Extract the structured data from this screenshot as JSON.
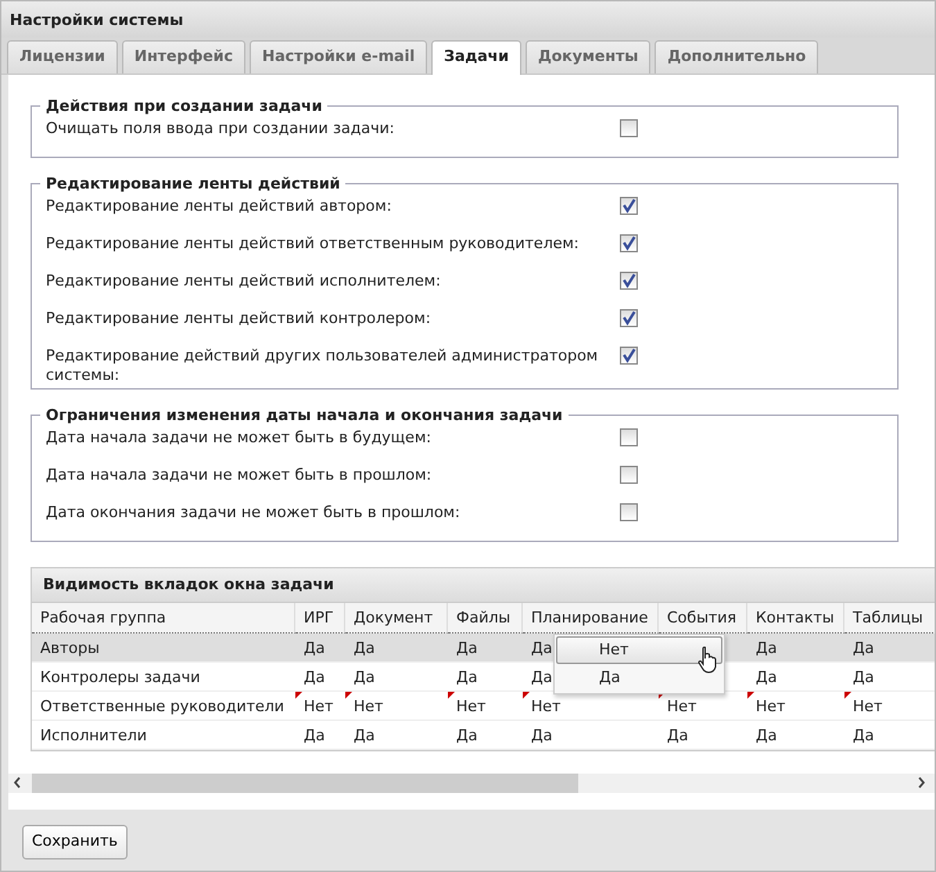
{
  "window": {
    "title": "Настройки системы"
  },
  "tabs": [
    {
      "label": "Лицензии",
      "selected": false
    },
    {
      "label": "Интерфейс",
      "selected": false
    },
    {
      "label": "Настройки e-mail",
      "selected": false
    },
    {
      "label": "Задачи",
      "selected": true
    },
    {
      "label": "Документы",
      "selected": false
    },
    {
      "label": "Дополнительно",
      "selected": false
    }
  ],
  "groups": [
    {
      "title": "Действия при создании задачи",
      "options": [
        {
          "label": "Очищать поля ввода при создании задачи:",
          "checked": false
        }
      ]
    },
    {
      "title": "Редактирование ленты действий",
      "options": [
        {
          "label": "Редактирование ленты действий автором:",
          "checked": true
        },
        {
          "label": "Редактирование ленты действий ответственным руководителем:",
          "checked": true
        },
        {
          "label": "Редактирование ленты действий исполнителем:",
          "checked": true
        },
        {
          "label": "Редактирование ленты действий контролером:",
          "checked": true
        },
        {
          "label": "Редактирование действий других пользователей администратором системы:",
          "checked": true
        }
      ]
    },
    {
      "title": "Ограничения изменения даты начала и окончания задачи",
      "options": [
        {
          "label": "Дата начала задачи не может быть в будущем:",
          "checked": false
        },
        {
          "label": "Дата начала задачи не может быть в прошлом:",
          "checked": false
        },
        {
          "label": "Дата окончания задачи не может быть в прошлом:",
          "checked": false
        }
      ]
    }
  ],
  "grid": {
    "title": "Видимость вкладок окна задачи",
    "columns": [
      "Рабочая группа",
      "ИРГ",
      "Документ",
      "Файлы",
      "Планирование",
      "События",
      "Контакты",
      "Таблицы"
    ],
    "rows": [
      {
        "selected": true,
        "modified": false,
        "cells": [
          "Авторы",
          "Да",
          "Да",
          "Да",
          "Да",
          null,
          "Да",
          "Да"
        ]
      },
      {
        "selected": false,
        "modified": false,
        "cells": [
          "Контролеры задачи",
          "Да",
          "Да",
          "Да",
          "Да",
          null,
          "Да",
          "Да"
        ]
      },
      {
        "selected": false,
        "modified": true,
        "cells": [
          "Ответственные руководители",
          "Нет",
          "Нет",
          "Нет",
          "Нет",
          "Нет",
          "Нет",
          "Нет"
        ]
      },
      {
        "selected": false,
        "modified": false,
        "cells": [
          "Исполнители",
          "Да",
          "Да",
          "Да",
          "Да",
          "Да",
          "Да",
          "Да"
        ]
      }
    ],
    "dropdown": [
      {
        "text": "Нет",
        "selected": true
      },
      {
        "text": "Да",
        "selected": false
      }
    ]
  },
  "buttons": [
    "Сохранить"
  ]
}
